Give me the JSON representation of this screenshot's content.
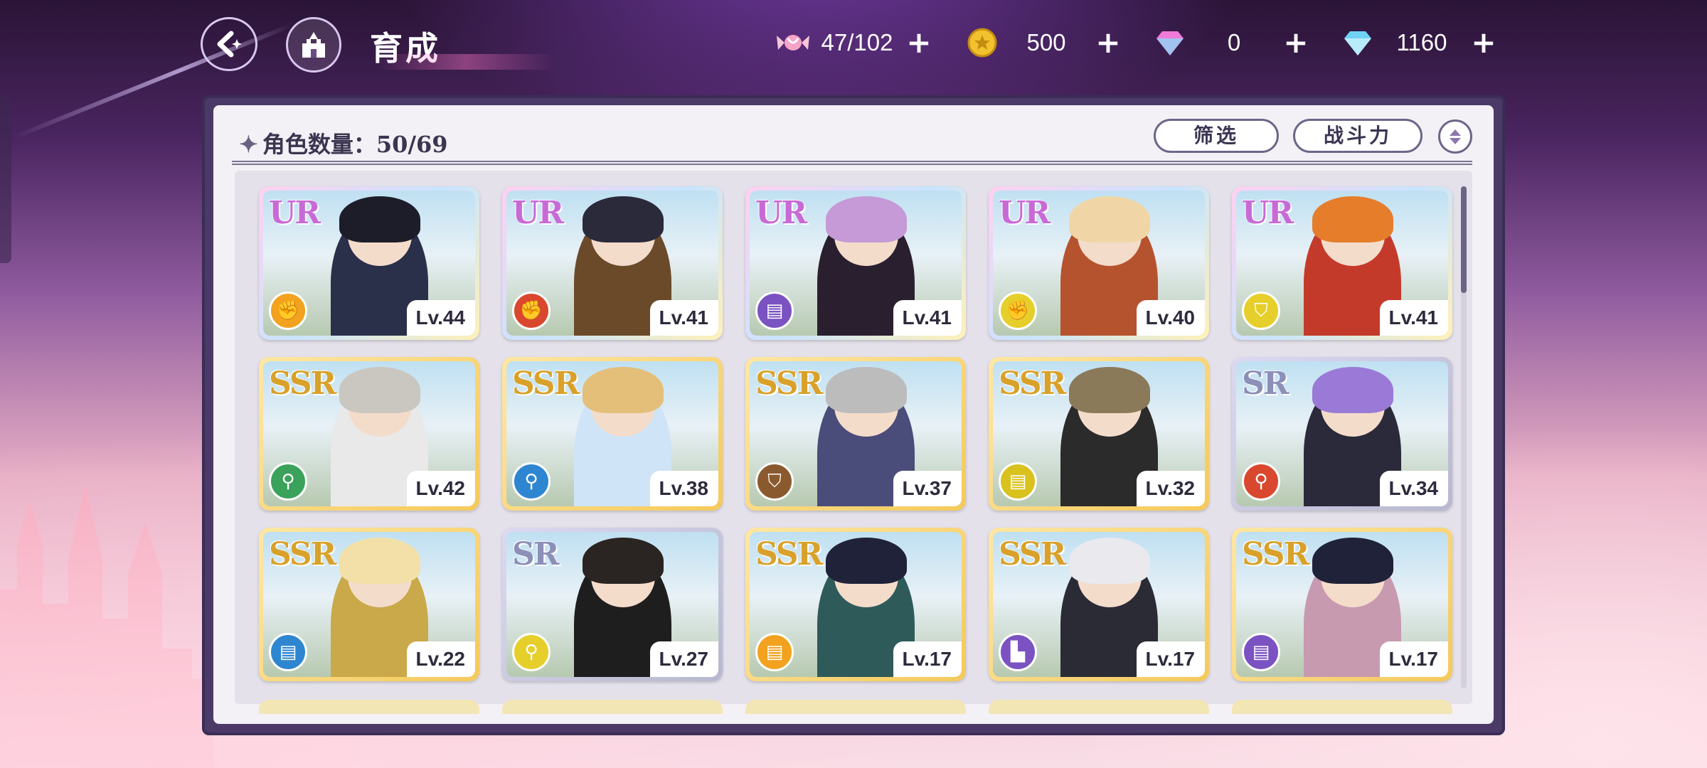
{
  "header": {
    "title": "育成",
    "resources": [
      {
        "name": "candy-icon",
        "value": "47/102",
        "color": "#e88fb8"
      },
      {
        "name": "gold-coin-icon",
        "value": "500",
        "color": "#f2c12e"
      },
      {
        "name": "pink-gem-icon",
        "value": "0",
        "color": "#f07ad8"
      },
      {
        "name": "blue-diamond-icon",
        "value": "1160",
        "color": "#6fd2f5"
      }
    ]
  },
  "panel": {
    "count_label": "角色数量：50/69",
    "filter_label": "筛选",
    "sort_label": "战斗力"
  },
  "cards": [
    {
      "rarity": "UR",
      "level": "Lv.44",
      "role": "fist",
      "role_color": "#f2a21e",
      "hair": "#1d1d2a",
      "outfit": "#2a2f4a"
    },
    {
      "rarity": "UR",
      "level": "Lv.41",
      "role": "fist",
      "role_color": "#d9482e",
      "hair": "#2b2a3a",
      "outfit": "#6b4a2a"
    },
    {
      "rarity": "UR",
      "level": "Lv.41",
      "role": "book",
      "role_color": "#7b52c2",
      "hair": "#c59ad6",
      "outfit": "#2a1f2f"
    },
    {
      "rarity": "UR",
      "level": "Lv.40",
      "role": "fist",
      "role_color": "#e6cf2a",
      "hair": "#f0d6a6",
      "outfit": "#b5532e"
    },
    {
      "rarity": "UR",
      "level": "Lv.41",
      "role": "shield",
      "role_color": "#e6cf2a",
      "hair": "#e57d2b",
      "outfit": "#c43a2a"
    },
    {
      "rarity": "SSR",
      "level": "Lv.42",
      "role": "staff",
      "role_color": "#3aa25a",
      "hair": "#c9c7bf",
      "outfit": "#e9e9ea"
    },
    {
      "rarity": "SSR",
      "level": "Lv.38",
      "role": "staff",
      "role_color": "#2e86d1",
      "hair": "#e4bf7a",
      "outfit": "#cfe4f6"
    },
    {
      "rarity": "SSR",
      "level": "Lv.37",
      "role": "shield",
      "role_color": "#8a5a2e",
      "hair": "#bcbcbc",
      "outfit": "#4a4c7a"
    },
    {
      "rarity": "SSR",
      "level": "Lv.32",
      "role": "book",
      "role_color": "#d9c21e",
      "hair": "#8b7a5a",
      "outfit": "#2b2b2b"
    },
    {
      "rarity": "SR",
      "level": "Lv.34",
      "role": "staff",
      "role_color": "#d9482e",
      "hair": "#9a7ad6",
      "outfit": "#2a2a3a"
    },
    {
      "rarity": "SSR",
      "level": "Lv.22",
      "role": "book",
      "role_color": "#2e86d1",
      "hair": "#f2e0a8",
      "outfit": "#c9a94a"
    },
    {
      "rarity": "SR",
      "level": "Lv.27",
      "role": "staff",
      "role_color": "#e6cf2a",
      "hair": "#2a2422",
      "outfit": "#1e1e1e"
    },
    {
      "rarity": "SSR",
      "level": "Lv.17",
      "role": "book",
      "role_color": "#f2a21e",
      "hair": "#1f2238",
      "outfit": "#2f5a5a"
    },
    {
      "rarity": "SSR",
      "level": "Lv.17",
      "role": "boot",
      "role_color": "#7b52c2",
      "hair": "#e9e9ee",
      "outfit": "#2b2b36"
    },
    {
      "rarity": "SSR",
      "level": "Lv.17",
      "role": "book",
      "role_color": "#7b52c2",
      "hair": "#1f2238",
      "outfit": "#c79ab0"
    }
  ]
}
